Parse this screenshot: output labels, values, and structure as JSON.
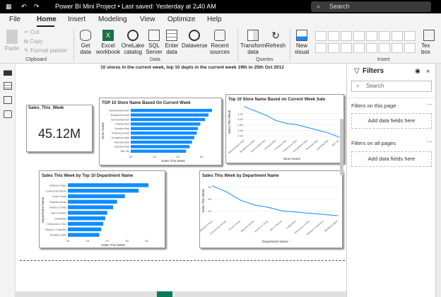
{
  "titlebar": {
    "title": "Power BI Mini Project • Last saved: Yesterday at 2:40 AM",
    "search": "Search"
  },
  "menu": {
    "file": "File",
    "home": "Home",
    "insert": "Insert",
    "modeling": "Modeling",
    "view": "View",
    "optimize": "Optimize",
    "help": "Help"
  },
  "clipboard": {
    "paste": "Paste",
    "cut": "Cut",
    "copy": "Copy",
    "format_painter": "Format painter",
    "group": "Clipboard"
  },
  "data": {
    "get_data": "Get data",
    "excel": "Excel workbook",
    "onelake": "OneLake catalog",
    "sql": "SQL Server",
    "enter": "Enter data",
    "dataverse": "Dataverse",
    "recent": "Recent sources",
    "group": "Data"
  },
  "queries": {
    "transform": "Transform data",
    "refresh": "Refresh",
    "group": "Queries"
  },
  "insert": {
    "new_visual": "New visual",
    "group": "Insert",
    "text_box": "Tex box"
  },
  "canvas_title": "10 stores in the current week, top 10 depts in the current week 19th to 25th Oct 2012",
  "kpi": {
    "title": "Sales_This_Week",
    "value": "45.12M"
  },
  "filters": {
    "title": "Filters",
    "search": "Search",
    "on_page": "Filters on this page",
    "on_all": "Filters on all pages",
    "add": "Add data fields here"
  },
  "chart_data": [
    {
      "type": "bar",
      "orientation": "horizontal",
      "title": "TOP 10 Store Name Based On Current Week",
      "xlabel": "Sales This Week",
      "ylabel": "Store Name",
      "categories": [
        "Westmoreland Mart",
        "Shopbemond Mart",
        "Summerfield Mart",
        "Parkside Mart",
        "Crossline Mart",
        "Timberwood Mart",
        "Georgetown Mart",
        "Riverside Mart",
        "Lakeview Mart",
        "Star City"
      ],
      "values": [
        3.45,
        3.3,
        3.15,
        2.95,
        2.85,
        2.8,
        2.7,
        2.6,
        2.5,
        2.35
      ],
      "xticks": [
        "0M",
        "1M",
        "2M",
        "3M"
      ],
      "xlim": [
        0,
        3.6
      ],
      "color": "#118dff"
    },
    {
      "type": "line",
      "title": "Top 10 Store Name Based on Current Week Sale",
      "xlabel": "Store Name",
      "ylabel": "Sales This Week",
      "categories": [
        "Westmoreland Mart",
        "Shopbemond Mart",
        "Summerfield Mart",
        "Parkside Mart",
        "Crossline Mart",
        "Timberwood Mart",
        "Georgetown Mart",
        "Riverside Mart",
        "Lakeview Mart",
        "Star City"
      ],
      "values": [
        3.45,
        3.3,
        3.15,
        2.95,
        2.85,
        2.8,
        2.7,
        2.6,
        2.5,
        2.35
      ],
      "yticks": [
        "2.4M",
        "2.6M",
        "2.8M",
        "3.0M",
        "3.2M"
      ],
      "ylim": [
        2.3,
        3.5
      ],
      "color": "#118dff"
    },
    {
      "type": "bar",
      "orientation": "horizontal",
      "title": "Sales This Week by Top 10 Department Name",
      "xlabel": "Sales This Week",
      "ylabel": "Department Name",
      "categories": [
        "Software & Apps",
        "Commercial Kitchen",
        "Frozen Foods",
        "Business Books",
        "Snacks & Candy",
        "Men's Fashion",
        "Collectibles",
        "Electronics & Tech",
        "Beauty & Cosmetics",
        "Bedding & Bath"
      ],
      "values": [
        4.1,
        3.6,
        2.9,
        2.5,
        2.3,
        2.0,
        1.9,
        1.8,
        1.7,
        1.6
      ],
      "xticks": [
        "0M",
        "1M",
        "2M",
        "3M",
        "4M"
      ],
      "xlim": [
        0,
        4.6
      ],
      "color": "#118dff"
    },
    {
      "type": "line",
      "title": "Sales This Week by Department Name",
      "xlabel": "Department Name",
      "ylabel": "Sales This Week",
      "categories": [
        "Software & Apps",
        "Commercial Kitchen",
        "Frozen Foods",
        "Business Books",
        "Snacks & Candy",
        "Men's Fashion",
        "Collectibles",
        "Electronics & Tech",
        "Beauty & Cosmetics",
        "Bedding & Bath"
      ],
      "values": [
        4.1,
        3.6,
        2.9,
        2.5,
        2.3,
        2.0,
        1.9,
        1.8,
        1.7,
        1.6
      ],
      "yticks": [
        "2M",
        "3M",
        "4M"
      ],
      "ylim": [
        1.3,
        4.4
      ],
      "color": "#118dff"
    }
  ]
}
